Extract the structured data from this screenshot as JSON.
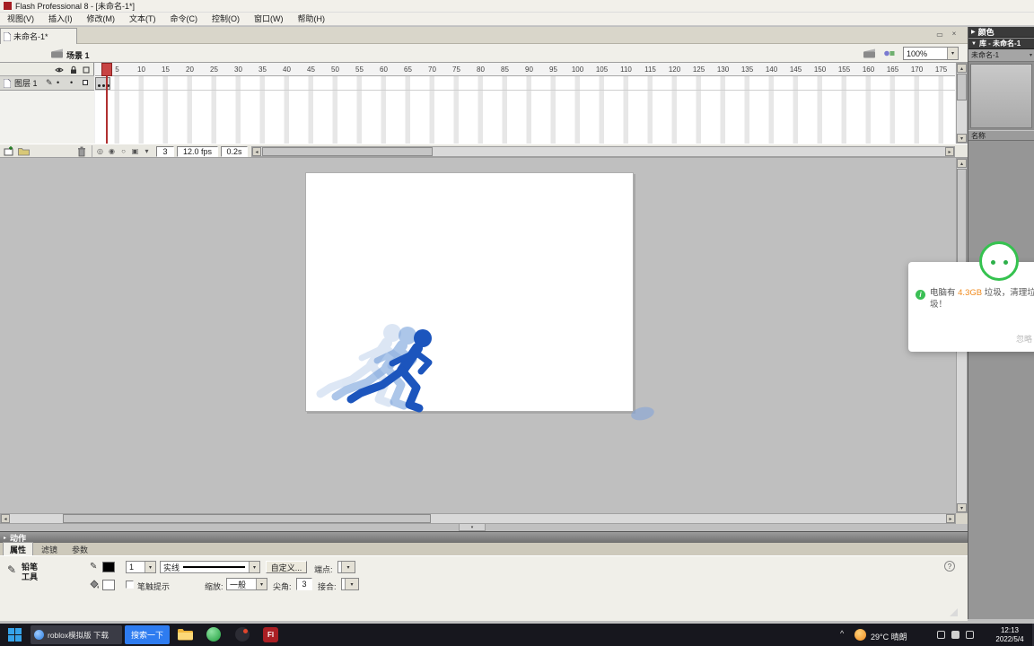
{
  "window": {
    "title": "Flash Professional 8 - [未命名-1*]"
  },
  "menu_bar": {
    "items": [
      "视图(V)",
      "插入(I)",
      "修改(M)",
      "文本(T)",
      "命令(C)",
      "控制(O)",
      "窗口(W)",
      "帮助(H)"
    ]
  },
  "document": {
    "tab_title": "未命名-1*"
  },
  "edit_bar": {
    "scene_name": "场景 1",
    "zoom_value": "100%"
  },
  "timeline": {
    "layer_name": "图层 1",
    "ruler_numbers": [
      "5",
      "10",
      "15",
      "20",
      "25",
      "30",
      "35",
      "40",
      "45",
      "50",
      "55",
      "60",
      "65",
      "70",
      "75",
      "80",
      "85",
      "90",
      "95",
      "100",
      "105",
      "110",
      "115",
      "120",
      "125",
      "130",
      "135",
      "140",
      "145",
      "150",
      "155",
      "160",
      "165",
      "170",
      "175"
    ],
    "current_frame": "3",
    "frame_rate": "12.0 fps",
    "elapsed_time": "0.2s"
  },
  "right_panels": {
    "color_panel_title": "颜色",
    "library_panel_title": "库 - 未命名-1",
    "library_document": "未命名-1",
    "name_column": "名称"
  },
  "actions_panel": {
    "title": "动作"
  },
  "properties_panel": {
    "tabs": [
      "属性",
      "滤镜",
      "参数"
    ],
    "tool_name_line1": "铅笔",
    "tool_name_line2": "工具",
    "stroke_width": "1",
    "stroke_style": "实线",
    "custom_button": "自定义...",
    "cap_label": "端点:",
    "stroke_hint_label": "笔触提示",
    "scale_label": "缩放:",
    "scale_value": "一般",
    "miter_label": "尖角:",
    "miter_value": "3",
    "join_label": "接合:"
  },
  "toast": {
    "text_prefix": "电脑有 ",
    "text_highlight": "4.3GB",
    "text_suffix": " 垃圾，清理垃圾！",
    "dismiss_label": "忽略"
  },
  "taskbar": {
    "search_window_title": "roblox模拟版 下载",
    "search_button_label": "搜索一下",
    "flash_icon_text": "Fl",
    "weather": "29°C 晴朗",
    "time": "12:13",
    "date": "2022/5/4"
  },
  "colors": {
    "accent_blue": "#2e7cf0",
    "figure_blue": "#1c55bd",
    "playhead_red": "#b03030",
    "toast_green": "#35c24f",
    "toast_highlight_orange": "#f08a1d"
  }
}
